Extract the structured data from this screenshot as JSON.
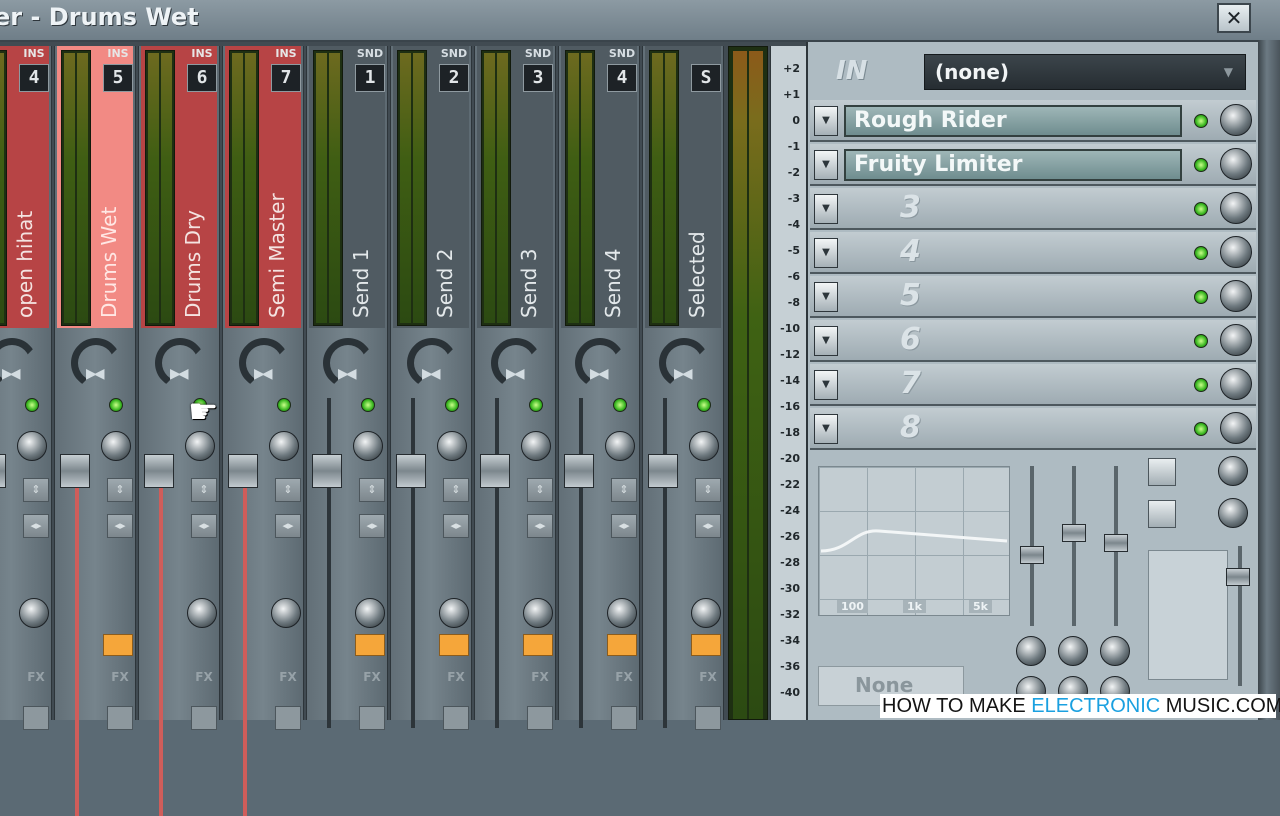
{
  "window": {
    "title": "er - Drums Wet",
    "close_label": "✕"
  },
  "mixer": {
    "strips": [
      {
        "kind": "INS",
        "number": "4",
        "label": "open hihat",
        "type": "ins"
      },
      {
        "kind": "INS",
        "number": "5",
        "label": "Drums Wet",
        "type": "sel"
      },
      {
        "kind": "INS",
        "number": "6",
        "label": "Drums Dry",
        "type": "ins"
      },
      {
        "kind": "INS",
        "number": "7",
        "label": "Semi Master",
        "type": "ins"
      },
      {
        "kind": "SND",
        "number": "1",
        "label": "Send 1",
        "type": "snd"
      },
      {
        "kind": "SND",
        "number": "2",
        "label": "Send 2",
        "type": "snd"
      },
      {
        "kind": "SND",
        "number": "3",
        "label": "Send 3",
        "type": "snd"
      },
      {
        "kind": "SND",
        "number": "4",
        "label": "Send 4",
        "type": "snd"
      },
      {
        "kind": "",
        "number": "S",
        "label": "Selected",
        "type": "snd"
      }
    ],
    "fx_label": "FX",
    "scale_ticks": [
      "+2",
      "+1",
      "0",
      "-1",
      "-2",
      "-3",
      "-4",
      "-5",
      "-6",
      "-8",
      "-10",
      "-12",
      "-14",
      "-16",
      "-18",
      "-20",
      "-22",
      "-24",
      "-26",
      "-28",
      "-30",
      "-32",
      "-34",
      "-36",
      "-40"
    ]
  },
  "fx_panel": {
    "input_label": "IN",
    "input_value": "(none)",
    "slots": [
      {
        "name": "Rough Rider",
        "number": ""
      },
      {
        "name": "Fruity Limiter",
        "number": ""
      },
      {
        "name": "",
        "number": "3"
      },
      {
        "name": "",
        "number": "4"
      },
      {
        "name": "",
        "number": "5"
      },
      {
        "name": "",
        "number": "6"
      },
      {
        "name": "",
        "number": "7"
      },
      {
        "name": "",
        "number": "8"
      }
    ],
    "eq_freqs": [
      "100",
      "1k",
      "5k"
    ],
    "output_value": "None"
  },
  "watermark": {
    "part1": "HOW TO MAKE ",
    "part2": "ELECTRONIC",
    "part3": " MUSIC.COM"
  },
  "colors": {
    "insert_strip": "#b74445",
    "selected_strip": "#f28a84",
    "send_strip": "#505b62",
    "led_green": "#37b51f",
    "accent_orange": "#f5a63a"
  },
  "icons": {
    "close": "close-icon",
    "pointer": "hand-pointer-icon"
  }
}
